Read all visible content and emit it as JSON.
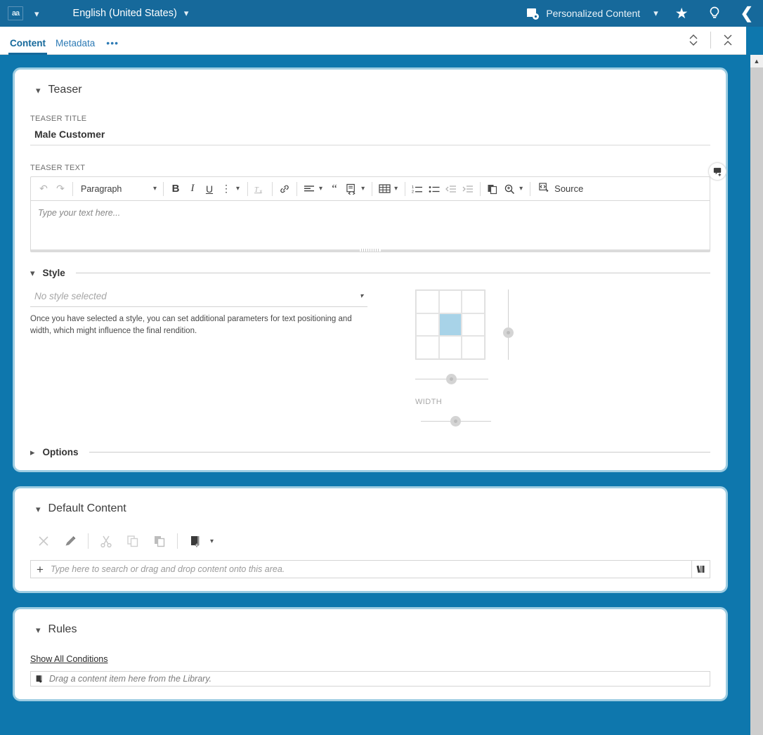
{
  "topbar": {
    "logo_text": "aa",
    "language": "English (United States)",
    "personalized_content": "Personalized Content",
    "icons": {
      "logo": "app-logo-icon",
      "dropdown": "chevron-down-icon",
      "lang_dropdown": "chevron-down-icon",
      "pc_icon": "personalized-content-icon",
      "pc_dropdown": "chevron-down-icon",
      "favorites": "star-icon",
      "hints": "lightbulb-icon",
      "collapse_panel": "chevron-left-icon"
    }
  },
  "tabs": {
    "items": [
      {
        "label": "Content",
        "active": true
      },
      {
        "label": "Metadata",
        "active": false
      }
    ],
    "overflow_label": "•••",
    "controls": {
      "expand_collapse": "chevron-up-down-icon",
      "collapse_all": "collapse-all-icon"
    }
  },
  "teaser": {
    "section_title": "Teaser",
    "title_label": "TEASER TITLE",
    "title_value": "Male Customer",
    "text_label": "TEASER TEXT",
    "editor_placeholder": "Type your text here...",
    "comment_icon": "add-comment-icon",
    "toolbar": {
      "undo": "↶",
      "redo": "↷",
      "paragraph_style": "Paragraph",
      "bold": "B",
      "italic": "I",
      "underline": "U",
      "more_text": "⋮",
      "remove_format": "Tx",
      "link": "link-icon",
      "align": "align-left-icon",
      "blockquote": "“",
      "insert_template": "insert-template-icon",
      "table": "table-icon",
      "numbered_list": "numbered-list-icon",
      "bulleted_list": "bulleted-list-icon",
      "outdent": "outdent-icon",
      "indent": "indent-icon",
      "paste": "paste-icon",
      "find_replace": "find-replace-icon",
      "source_label": "Source",
      "source_icon": "source-code-icon"
    }
  },
  "style": {
    "section_title": "Style",
    "select_placeholder": "No style selected",
    "hint": "Once you have selected a style, you can set additional parameters for text positioning and width, which might influence the final rendition.",
    "grid": {
      "rows": 3,
      "cols": 3,
      "selected_index": 4
    },
    "width_label": "WIDTH"
  },
  "options": {
    "section_title": "Options",
    "expanded": false
  },
  "default_content": {
    "section_title": "Default Content",
    "toolbar": [
      {
        "name": "remove-icon",
        "glyph": "✕",
        "state": "disabled"
      },
      {
        "name": "edit-icon",
        "glyph": "✎",
        "state": "enabled"
      },
      {
        "name": "cut-icon",
        "glyph": "✂",
        "state": "disabled"
      },
      {
        "name": "copy-icon",
        "glyph": "❐",
        "state": "disabled"
      },
      {
        "name": "paste-icon",
        "glyph": "❑",
        "state": "enabled"
      },
      {
        "name": "new-content-icon",
        "glyph": "■",
        "state": "enabled"
      }
    ],
    "new_content_dropdown": "chevron-down-icon",
    "search_placeholder": "Type here to search or drag and drop content onto this area.",
    "add_icon": "plus-icon",
    "library_icon": "library-icon"
  },
  "rules": {
    "section_title": "Rules",
    "show_all_conditions": "Show All Conditions",
    "drop_placeholder": "Drag a content item here from the Library.",
    "drop_icon": "add-content-icon"
  },
  "colors": {
    "header_blue": "#16699b",
    "background_blue": "#0e77ad",
    "card_border_blue": "#9ecde2",
    "accent_tab": "#16699b",
    "grid_selected": "#a8d3e8"
  }
}
